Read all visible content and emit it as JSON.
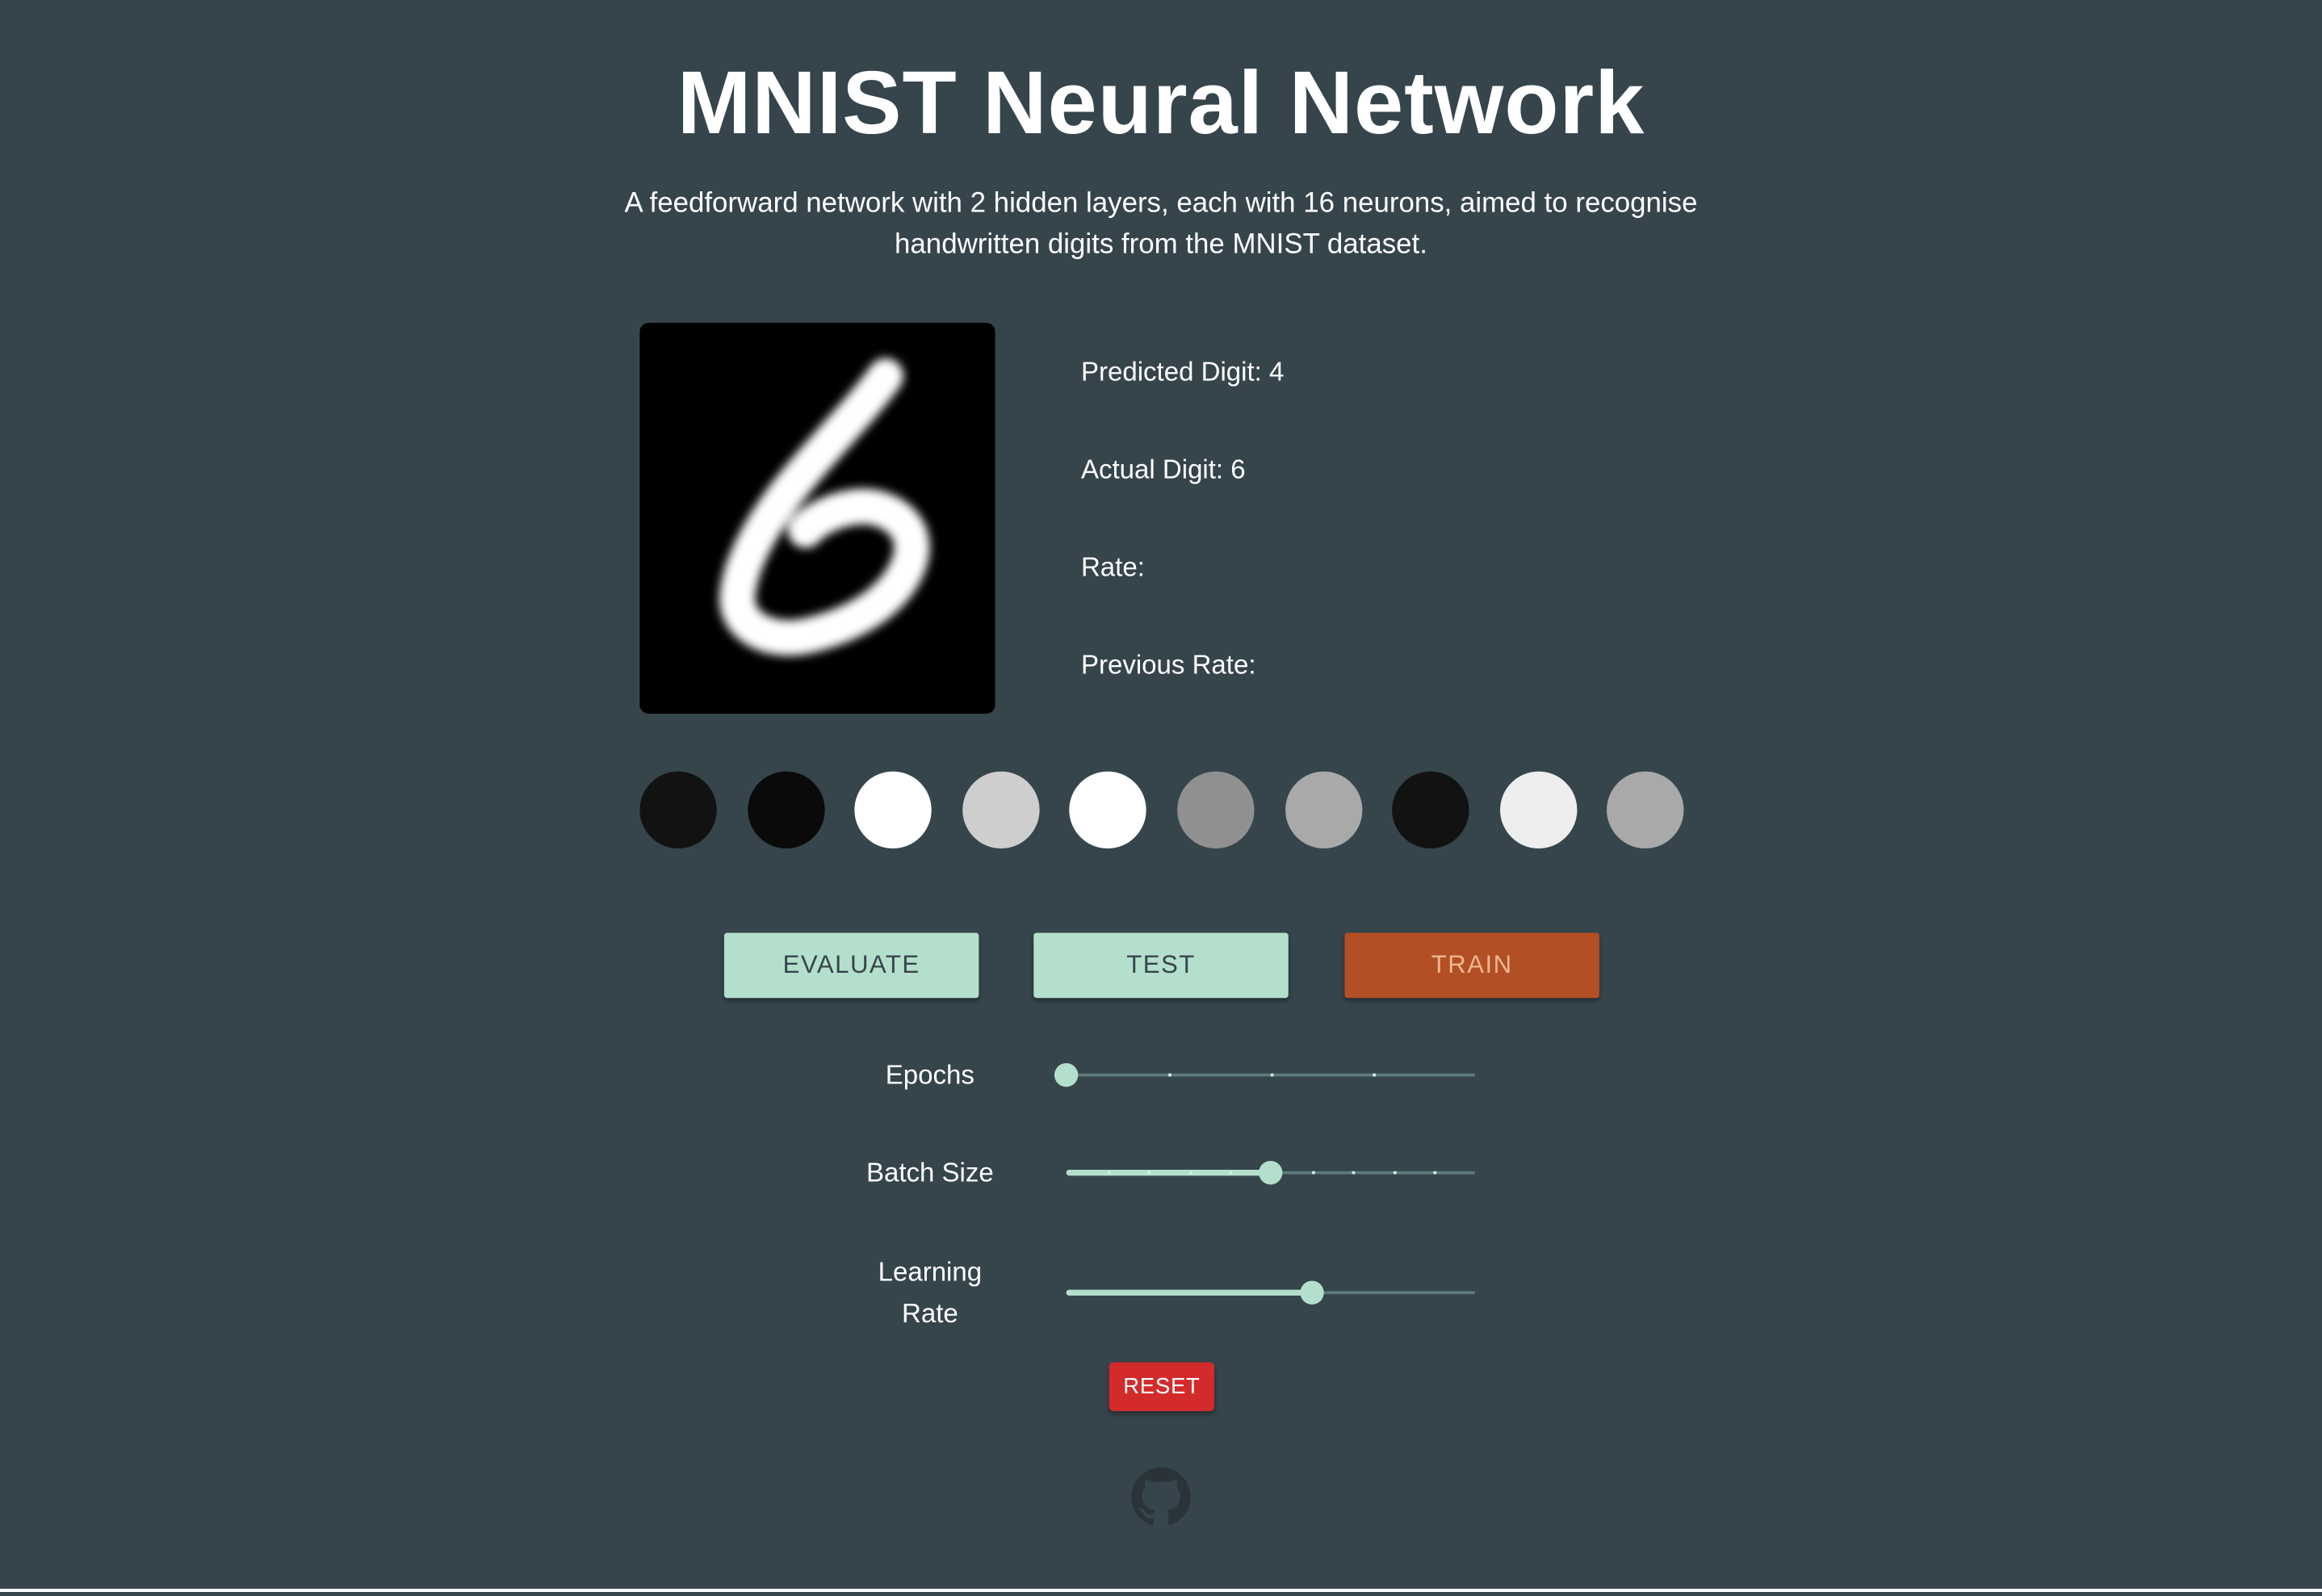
{
  "header": {
    "title": "MNIST Neural Network",
    "subtitle": "A feedforward network with 2 hidden layers, each with 16 neurons, aimed to recognise handwritten digits from the MNIST dataset."
  },
  "sample": {
    "image_description_icon": "mnist-digit-6",
    "predicted_label": "Predicted Digit:",
    "predicted_value": "4",
    "actual_label": "Actual Digit:",
    "actual_value": "6",
    "rate_label": "Rate:",
    "rate_value": "",
    "previous_rate_label": "Previous Rate:",
    "previous_rate_value": ""
  },
  "output_activations": [
    0.04,
    0.01,
    1.0,
    0.8,
    1.0,
    0.55,
    0.65,
    0.04,
    0.93,
    0.65
  ],
  "buttons": {
    "evaluate": "EVALUATE",
    "test": "TEST",
    "train": "TRAIN",
    "reset": "RESET"
  },
  "sliders": {
    "epochs": {
      "label": "Epochs",
      "position": 0.0,
      "ticks": 4
    },
    "batch_size": {
      "label": "Batch Size",
      "position": 0.5,
      "ticks": 10
    },
    "learning_rate": {
      "label_line1": "Learning",
      "label_line2": "Rate",
      "position": 0.6
    }
  },
  "footer": {
    "icon": "github-icon"
  },
  "colors": {
    "background": "#36454c",
    "accent": "#b4dfcc",
    "train": "#b24f24",
    "train_text": "#f0b58e",
    "reset": "#d32b2b",
    "github_icon": "#2a3438"
  }
}
